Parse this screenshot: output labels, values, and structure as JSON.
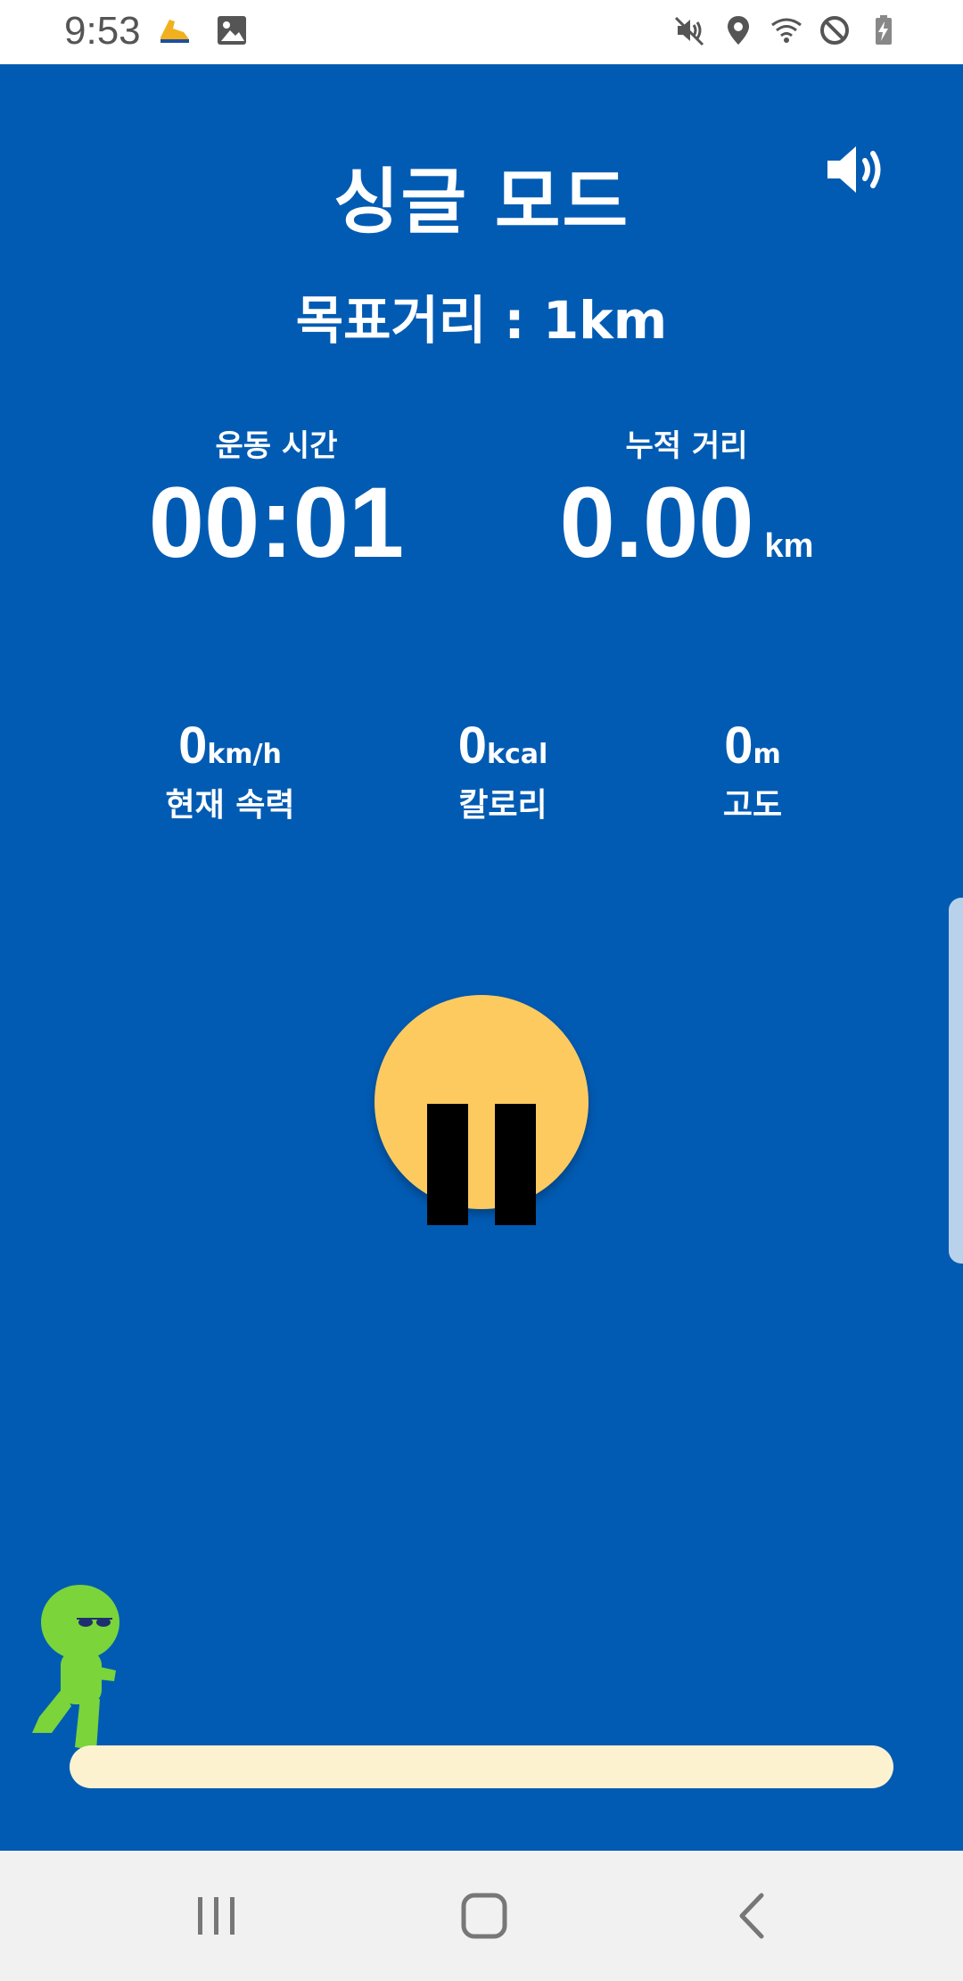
{
  "status_bar": {
    "time": "9:53",
    "left_icons": [
      "shoe-icon",
      "image-icon"
    ],
    "right_icons": [
      "mute-icon",
      "location-icon",
      "wifi-icon",
      "dnd-icon",
      "battery-charging-icon"
    ]
  },
  "header": {
    "title": "싱글 모드",
    "sound_icon": "volume-icon"
  },
  "target": {
    "text": "목표거리 : 1km"
  },
  "stats": {
    "time": {
      "label": "운동 시간",
      "value": "00:01"
    },
    "distance": {
      "label": "누적 거리",
      "value": "0.00",
      "unit": "km"
    }
  },
  "small_stats": [
    {
      "value": "0",
      "unit": "km/h",
      "label": "현재 속력"
    },
    {
      "value": "0",
      "unit": "kcal",
      "label": "칼로리"
    },
    {
      "value": "0",
      "unit": "m",
      "label": "고도"
    }
  ],
  "controls": {
    "pause_icon": "pause-icon"
  },
  "progress": {
    "fraction": 0.0
  },
  "colors": {
    "background": "#025bb3",
    "button": "#fdca60",
    "track": "#fdf2d0",
    "character": "#7ad43a"
  },
  "nav": {
    "icons": [
      "recent-apps-icon",
      "home-icon",
      "back-icon"
    ]
  }
}
